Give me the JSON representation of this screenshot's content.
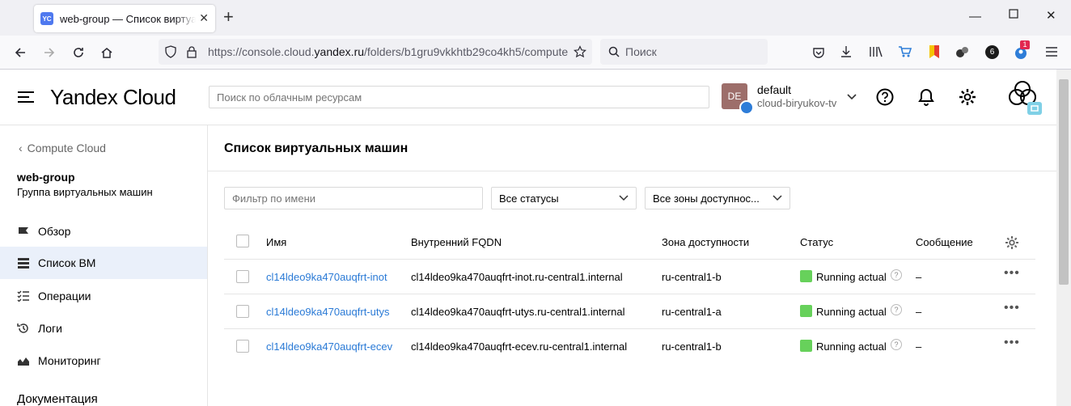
{
  "browser": {
    "tab_favicon": "YC",
    "tab_title": "web-group — Список виртуальных машин",
    "url_prefix": "https://console.cloud.",
    "url_domain": "yandex.ru",
    "url_path": "/folders/b1gru9vkkhtb29co4kh5/compute",
    "search_placeholder": "Поиск",
    "badge_count": "6",
    "notification_count": "1"
  },
  "header": {
    "logo": "Yandex Cloud",
    "search_placeholder": "Поиск по облачным ресурсам",
    "avatar_initials": "DE",
    "folder_name": "default",
    "cloud_name": "cloud-biryukov-tv"
  },
  "sidebar": {
    "back_label": "Compute Cloud",
    "group_name": "web-group",
    "group_subtitle": "Группа виртуальных машин",
    "items": [
      {
        "label": "Обзор",
        "icon": "flag-icon",
        "active": false
      },
      {
        "label": "Список ВМ",
        "icon": "server-list-icon",
        "active": true
      },
      {
        "label": "Операции",
        "icon": "checklist-icon",
        "active": false
      },
      {
        "label": "Логи",
        "icon": "history-icon",
        "active": false
      },
      {
        "label": "Мониторинг",
        "icon": "chart-icon",
        "active": false
      }
    ],
    "docs_label": "Документация"
  },
  "main": {
    "title": "Список виртуальных машин",
    "filter_placeholder": "Фильтр по имени",
    "status_select": "Все статусы",
    "zone_select": "Все зоны доступнос...",
    "columns": [
      "Имя",
      "Внутренний FQDN",
      "Зона доступности",
      "Статус",
      "Сообщение"
    ],
    "rows": [
      {
        "name": "cl14ldeo9ka470auqfrt-inot",
        "fqdn": "cl14ldeo9ka470auqfrt-inot.ru-central1.internal",
        "zone": "ru-central1-b",
        "status": "Running actual",
        "message": "–"
      },
      {
        "name": "cl14ldeo9ka470auqfrt-utys",
        "fqdn": "cl14ldeo9ka470auqfrt-utys.ru-central1.internal",
        "zone": "ru-central1-a",
        "status": "Running actual",
        "message": "–"
      },
      {
        "name": "cl14ldeo9ka470auqfrt-ecev",
        "fqdn": "cl14ldeo9ka470auqfrt-ecev.ru-central1.internal",
        "zone": "ru-central1-b",
        "status": "Running actual",
        "message": "–"
      }
    ]
  },
  "colors": {
    "accent": "#2a7ad6",
    "status_running": "#67d15b",
    "active_item_bg": "#eaf0fa"
  }
}
